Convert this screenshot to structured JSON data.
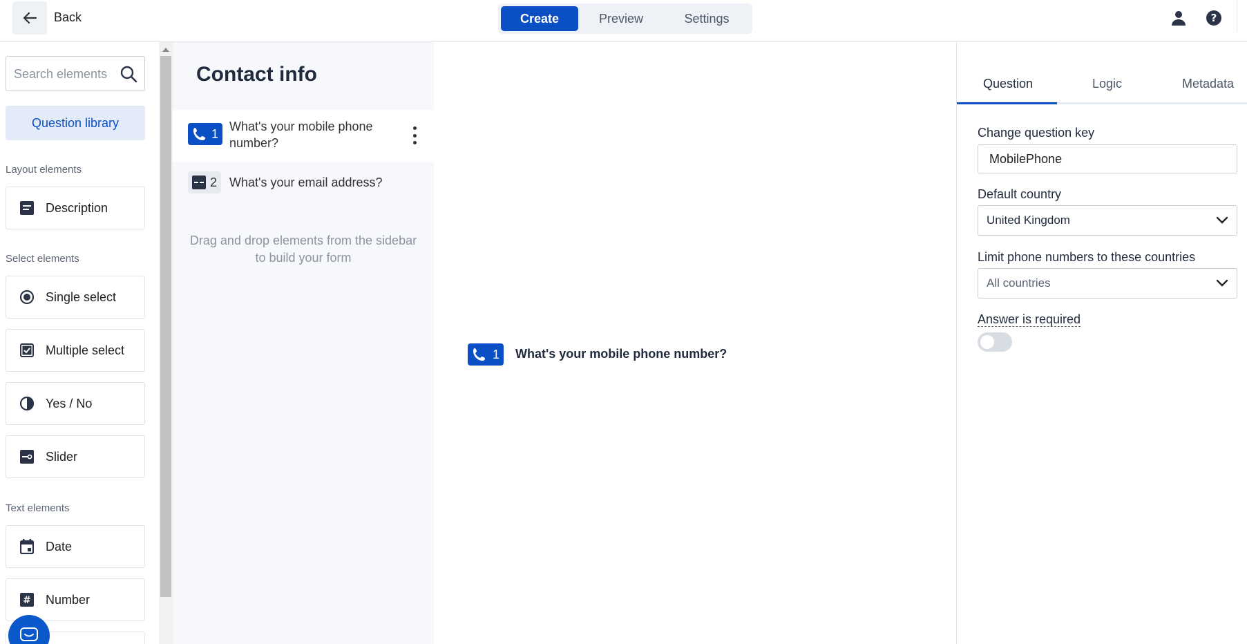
{
  "header": {
    "back_label": "Back",
    "tabs": [
      {
        "label": "Create",
        "active": true
      },
      {
        "label": "Preview",
        "active": false
      },
      {
        "label": "Settings",
        "active": false
      }
    ],
    "icons": [
      "back-arrow-icon",
      "user-icon",
      "help-icon"
    ]
  },
  "sidebar": {
    "search_placeholder": "Search elements",
    "library_button": "Question library",
    "sections": [
      {
        "label": "Layout elements",
        "items": [
          {
            "label": "Description",
            "icon": "description-icon"
          }
        ]
      },
      {
        "label": "Select elements",
        "items": [
          {
            "label": "Single select",
            "icon": "radio-icon"
          },
          {
            "label": "Multiple select",
            "icon": "checkbox-icon"
          },
          {
            "label": "Yes / No",
            "icon": "half-circle-icon"
          },
          {
            "label": "Slider",
            "icon": "slider-icon"
          }
        ]
      },
      {
        "label": "Text elements",
        "items": [
          {
            "label": "Date",
            "icon": "calendar-icon"
          },
          {
            "label": "Number",
            "icon": "hash-icon"
          }
        ]
      }
    ]
  },
  "form": {
    "title": "Contact info",
    "questions": [
      {
        "number": "1",
        "text": "What's your mobile phone number?",
        "icon": "phone-icon",
        "active": true
      },
      {
        "number": "2",
        "text": "What's your email address?",
        "icon": "short-text-icon",
        "active": false
      }
    ],
    "hint": "Drag and drop elements from the sidebar to build your form"
  },
  "preview": {
    "number": "1",
    "question": "What's your mobile phone number?"
  },
  "panel": {
    "tabs": [
      {
        "label": "Question",
        "active": true
      },
      {
        "label": "Logic",
        "active": false
      },
      {
        "label": "Metadata",
        "active": false
      }
    ],
    "question_key_label": "Change question key",
    "question_key_value": "MobilePhone",
    "default_country_label": "Default country",
    "default_country_value": "United Kingdom",
    "limit_label": "Limit phone numbers to these countries",
    "limit_value": "All countries",
    "required_label": "Answer is required",
    "required_on": false
  },
  "colors": {
    "accent": "#0a4fc4",
    "accent_light": "#e3ebf8",
    "text": "#1f2a3d"
  }
}
